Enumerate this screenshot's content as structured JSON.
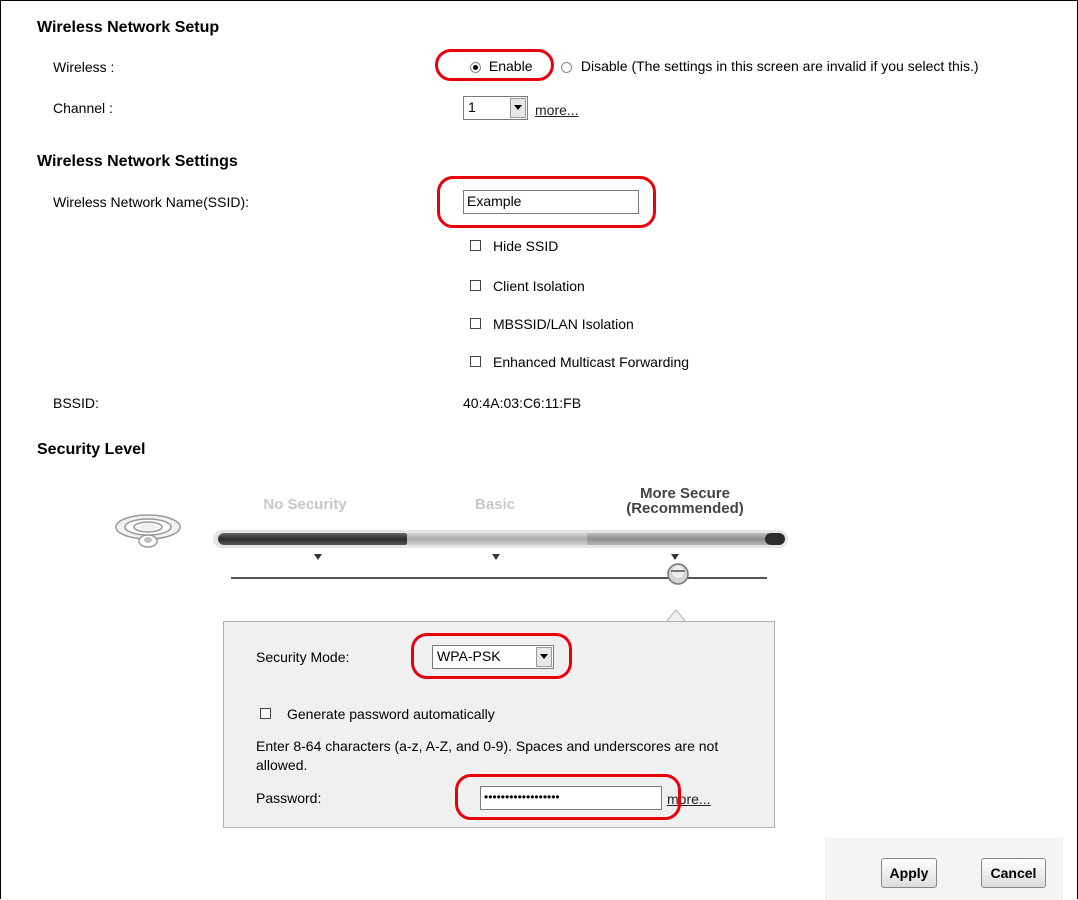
{
  "setup": {
    "title": "Wireless Network Setup",
    "wireless_label": "Wireless :",
    "enable_label": "Enable",
    "disable_label": "Disable (The settings in this screen are invalid if you select this.)",
    "wireless_state": "Enable",
    "channel_label": "Channel :",
    "channel_value": "1",
    "more_link": "more..."
  },
  "settings": {
    "title": "Wireless Network Settings",
    "ssid_label": "Wireless Network Name(SSID):",
    "ssid_value": "Example",
    "checkboxes": [
      {
        "label": "Hide SSID",
        "checked": false
      },
      {
        "label": "Client Isolation",
        "checked": false
      },
      {
        "label": "MBSSID/LAN Isolation",
        "checked": false
      },
      {
        "label": "Enhanced Multicast Forwarding",
        "checked": false
      }
    ],
    "bssid_label": "BSSID:",
    "bssid_value": "40:4A:03:C6:11:FB"
  },
  "security": {
    "title": "Security Level",
    "levels": [
      {
        "label": "No Security"
      },
      {
        "label": "Basic"
      },
      {
        "label": "More Secure\n(Recommended)"
      }
    ],
    "selected_level": "More Secure",
    "mode_label": "Security Mode:",
    "mode_value": "WPA-PSK",
    "generate_label": "Generate password automatically",
    "generate_checked": false,
    "hint": "Enter 8-64 characters (a-z, A-Z, and 0-9). Spaces and underscores are not allowed.",
    "password_label": "Password:",
    "password_value": "••••••••••••••••••",
    "more_link": "more..."
  },
  "buttons": {
    "apply": "Apply",
    "cancel": "Cancel"
  },
  "colors": {
    "highlight": "#e8000b"
  }
}
